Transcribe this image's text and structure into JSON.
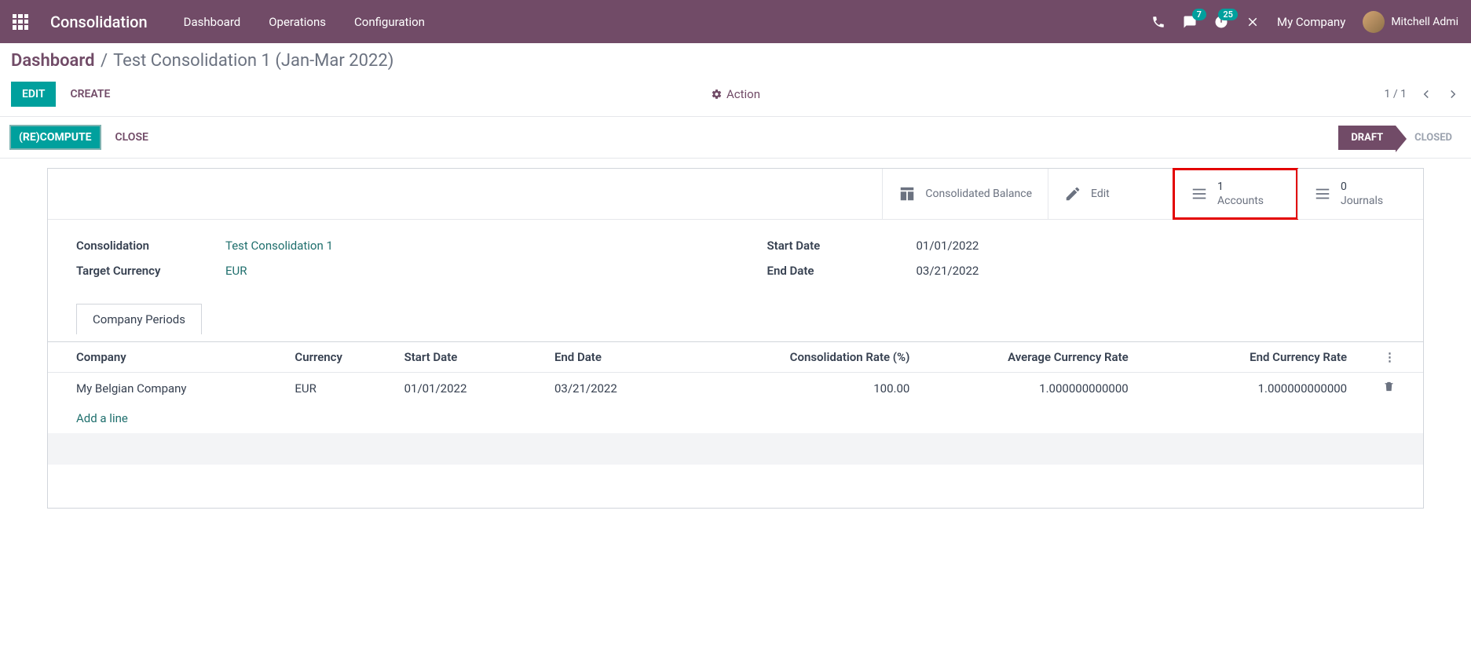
{
  "navbar": {
    "title": "Consolidation",
    "menu": [
      "Dashboard",
      "Operations",
      "Configuration"
    ],
    "msg_badge": "7",
    "activity_badge": "25",
    "company": "My Company",
    "user": "Mitchell Admi"
  },
  "crumb": {
    "root": "Dashboard",
    "current": "Test Consolidation 1 (Jan-Mar 2022)"
  },
  "cp": {
    "edit": "EDIT",
    "create": "CREATE",
    "action": "Action",
    "pager": "1 / 1"
  },
  "status": {
    "recompute": "(RE)COMPUTE",
    "close": "CLOSE",
    "draft": "DRAFT",
    "closed": "CLOSED"
  },
  "stats": {
    "balance": "Consolidated Balance",
    "edit": "Edit",
    "accounts_n": "1",
    "accounts_l": "Accounts",
    "journals_n": "0",
    "journals_l": "Journals"
  },
  "form": {
    "consolidation_l": "Consolidation",
    "consolidation_v": "Test Consolidation 1",
    "target_currency_l": "Target Currency",
    "target_currency_v": "EUR",
    "start_date_l": "Start Date",
    "start_date_v": "01/01/2022",
    "end_date_l": "End Date",
    "end_date_v": "03/21/2022"
  },
  "tab": {
    "label": "Company Periods"
  },
  "grid": {
    "h_company": "Company",
    "h_currency": "Currency",
    "h_sdate": "Start Date",
    "h_edate": "End Date",
    "h_crate": "Consolidation Rate (%)",
    "h_avg": "Average Currency Rate",
    "h_end": "End Currency Rate",
    "row": {
      "company": "My Belgian Company",
      "currency": "EUR",
      "sdate": "01/01/2022",
      "edate": "03/21/2022",
      "crate": "100.00",
      "avg": "1.000000000000",
      "end": "1.000000000000"
    },
    "add_line": "Add a line"
  }
}
